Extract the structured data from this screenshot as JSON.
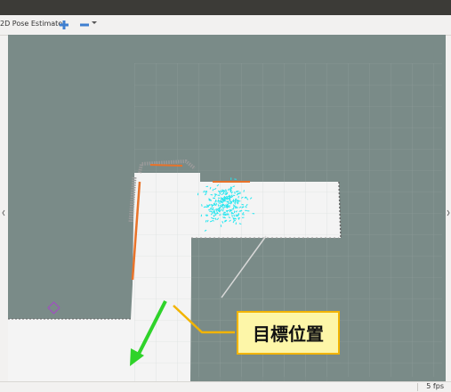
{
  "toolbar": {
    "pose_estimate_label": "2D Pose Estimate",
    "add_tool_icon": "plus-icon",
    "remove_tool_icon": "minus-icon"
  },
  "status": {
    "fps": "5 fps"
  },
  "annotation": {
    "label": "目標位置"
  },
  "colors": {
    "background": "#7a8b88",
    "free_space": "#f4f4f4",
    "obstacle_edge": "#e8732a",
    "particles": "#27e6f0",
    "arrow": "#2fd32a",
    "callout_fill": "#fdf6a8",
    "callout_border": "#f2b400"
  }
}
